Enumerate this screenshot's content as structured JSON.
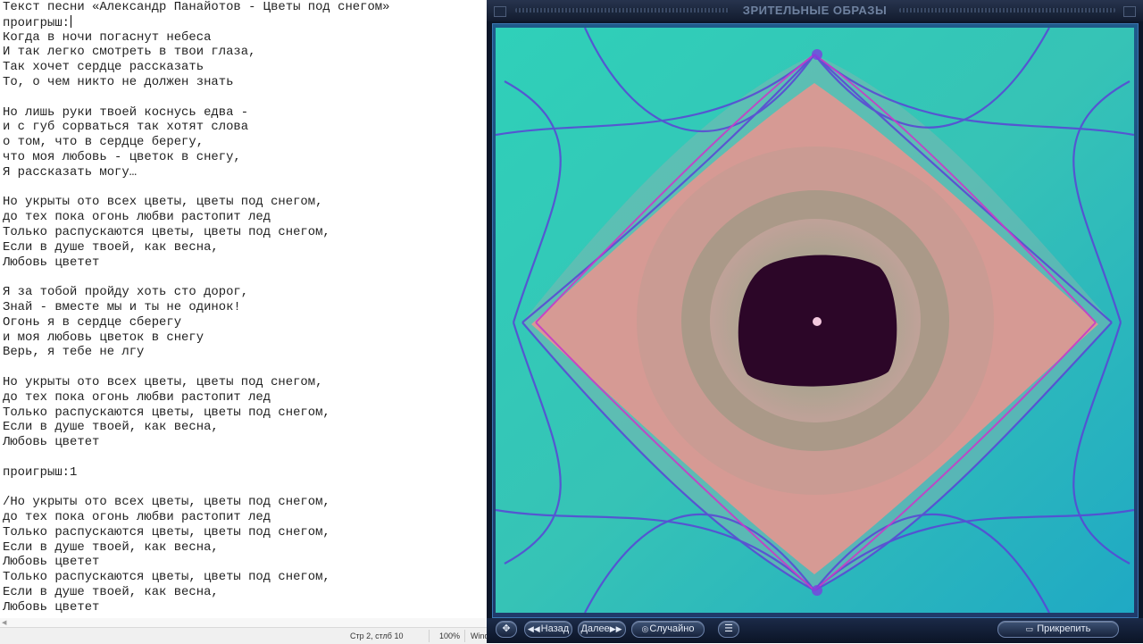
{
  "notepad": {
    "lines": [
      "Текст песни «Александр Панайотов - Цветы под снегом»",
      "проигрыш:",
      "Когда в ночи погаснут небеса",
      "И так легко смотреть в твои глаза,",
      "Так хочет сердце рассказать",
      "То, о чем никто не должен знать",
      "",
      "Но лишь руки твоей коснусь едва -",
      "и с губ сорваться так хотят слова",
      "о том, что в сердце берегу,",
      "что моя любовь - цветок в снегу,",
      "Я рассказать могу…",
      "",
      "Но укрыты ото всех цветы, цветы под снегом,",
      "до тех пока огонь любви растопит лед",
      "Только распускаются цветы, цветы под снегом,",
      "Если в душе твоей, как весна,",
      "Любовь цветет",
      "",
      "Я за тобой пройду хоть сто дорог,",
      "Знай - вместе мы и ты не одинок!",
      "Огонь я в сердце сберегу",
      "и моя любовь цветок в снегу",
      "Верь, я тебе не лгу",
      "",
      "Но укрыты ото всех цветы, цветы под снегом,",
      "до тех пока огонь любви растопит лед",
      "Только распускаются цветы, цветы под снегом,",
      "Если в душе твоей, как весна,",
      "Любовь цветет",
      "",
      "проигрыш:1",
      "",
      "/Но укрыты ото всех цветы, цветы под снегом,",
      "до тех пока огонь любви растопит лед",
      "Только распускаются цветы, цветы под снегом,",
      "Если в душе твоей, как весна,",
      "Любовь цветет",
      "Только распускаются цветы, цветы под снегом,",
      "Если в душе твоей, как весна,",
      "Любовь цветет"
    ],
    "status": {
      "position": "Стр 2, стлб 10",
      "zoom": "100%",
      "encoding": "Wind"
    }
  },
  "player": {
    "title": "ЗРИТЕЛЬНЫЕ ОБРАЗЫ",
    "buttons": {
      "back": "Назад",
      "next": "Далее",
      "random": "Случайно",
      "pin": "Прикрепить"
    },
    "icons": [
      "move-icon",
      "menu-icon",
      "pin-icon",
      "random-icon"
    ]
  },
  "colors": {
    "viz_teal": "#31c4b2",
    "viz_pink": "#d8948d",
    "viz_dark": "#2a0a22",
    "viz_lines": "#5b3fd6"
  }
}
